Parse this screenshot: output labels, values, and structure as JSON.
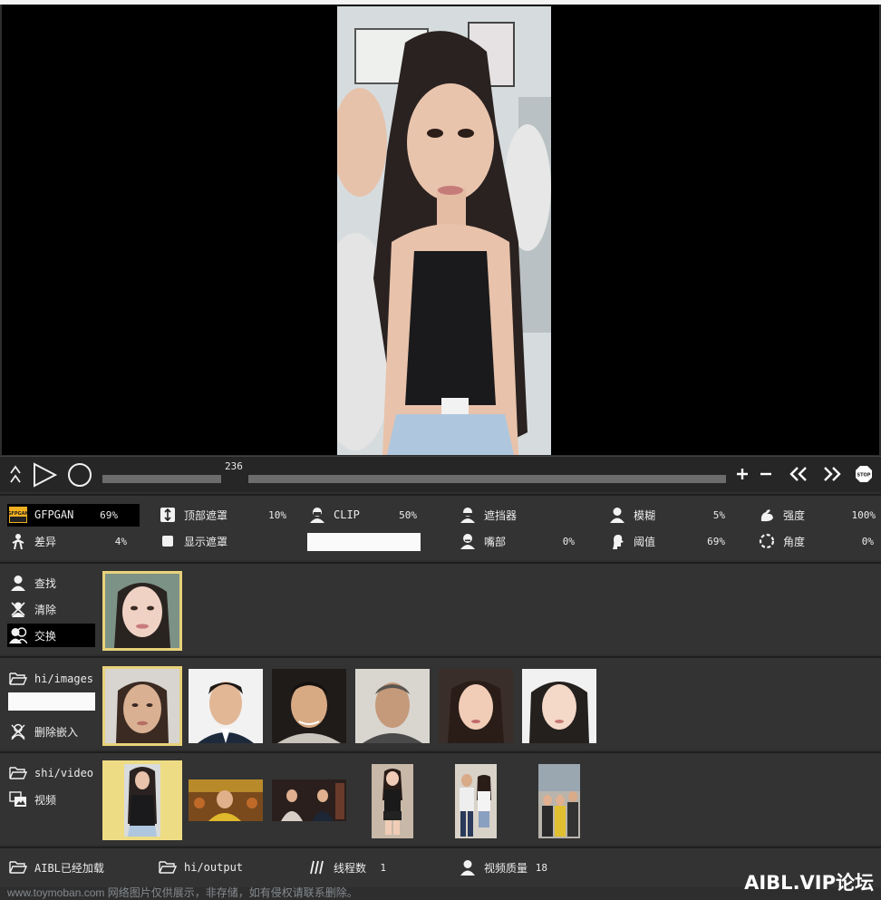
{
  "transport": {
    "frame": "236"
  },
  "settings": {
    "gfpgan": {
      "label": "GFPGAN",
      "value": "69%"
    },
    "top_mask": {
      "label": "顶部遮罩",
      "value": "10%"
    },
    "clip": {
      "label": "CLIP",
      "value": "50%"
    },
    "occluder": {
      "label": "遮挡器"
    },
    "blur": {
      "label": "模糊",
      "value": "5%"
    },
    "strength": {
      "label": "强度",
      "value": "100%"
    },
    "diff": {
      "label": "差异",
      "value": "4%"
    },
    "show_mask": {
      "label": "显示遮罩"
    },
    "mouth": {
      "label": "嘴部",
      "value": "0%"
    },
    "threshold": {
      "label": "阈值",
      "value": "69%"
    },
    "angle": {
      "label": "角度",
      "value": "0%"
    }
  },
  "faces": {
    "find": "查找",
    "clear": "清除",
    "swap": "交换"
  },
  "images": {
    "folder": "hi/images",
    "delete_embed": "删除嵌入"
  },
  "videos": {
    "folder": "shi/video",
    "video_label": "视频"
  },
  "bottom": {
    "loaded": "AIBL已经加载",
    "output": "hi/output",
    "threads_label": "线程数",
    "threads_value": "1",
    "quality_label": "视频质量",
    "quality_value": "18"
  },
  "watermarks": {
    "left": "www.toymoban.com 网络图片仅供展示，非存储，如有侵权请联系删除。",
    "right": "AIBL.VIP论坛"
  },
  "colors": {
    "accent_selected": "#e8d27a",
    "panel_bg": "#333333",
    "preview_bg": "#000000"
  }
}
